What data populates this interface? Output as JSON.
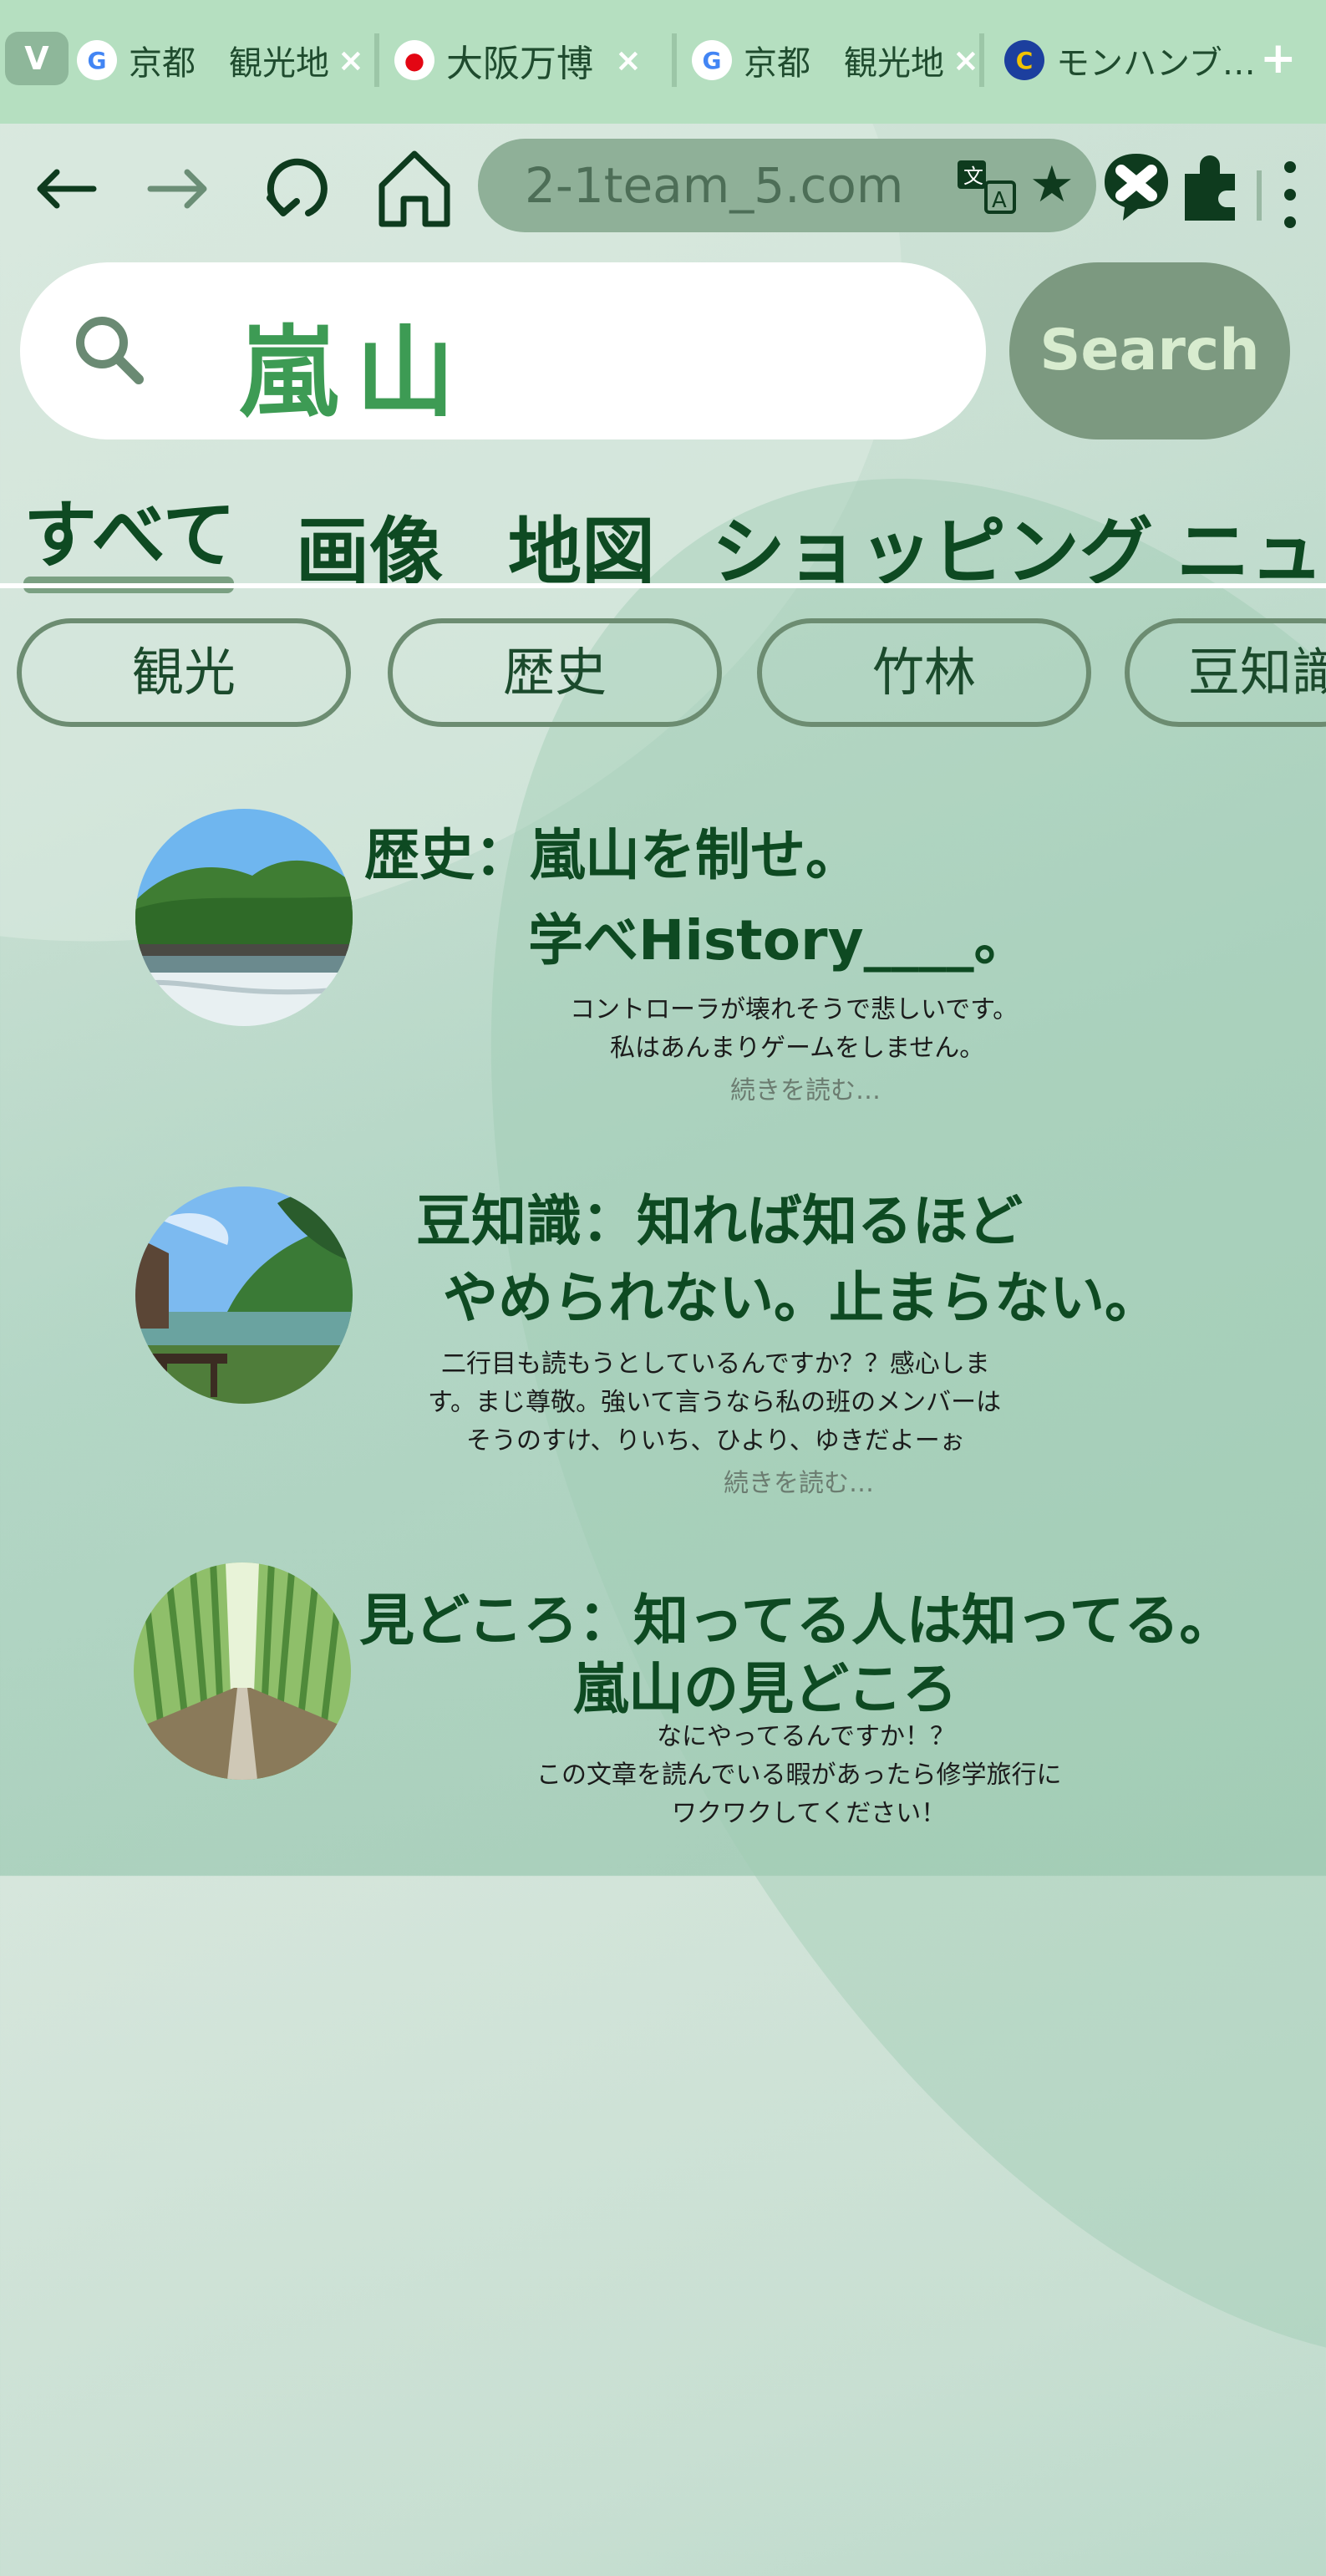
{
  "tabs": [
    {
      "title": "京都　観光地",
      "favicon": "google-icon"
    },
    {
      "title": "大阪万博",
      "favicon": "expo-icon"
    },
    {
      "title": "京都　観光地",
      "favicon": "google-icon"
    },
    {
      "title": "モンハンブ…",
      "favicon": "capcom-icon"
    }
  ],
  "tab_toggle": "V",
  "new_tab": "+",
  "address": {
    "url": "2-1team_5.com"
  },
  "search": {
    "query": "嵐山",
    "button": "Search"
  },
  "category_tabs": [
    "すべて",
    "画像",
    "地図",
    "ショッピング",
    "ニュー"
  ],
  "active_category": "すべて",
  "chips": [
    "観光",
    "歴史",
    "竹林",
    "豆知識"
  ],
  "results": [
    {
      "title_line1": "歴史：嵐山を制せ。",
      "title_line2": "学べHistory____。",
      "desc": [
        "コントローラが壊れそうで悲しいです。",
        "私はあんまりゲームをしません。"
      ],
      "more": "続きを読む…"
    },
    {
      "title_line1": "豆知識：知れば知るほど",
      "title_line2": "やめられない。止まらない。",
      "desc": [
        "二行目も読もうとしているんですか？？感心しま",
        "す。まじ尊敬。強いて言うなら私の班のメンバーは",
        "そうのすけ、りいち、ひより、ゆきだよーぉ"
      ],
      "more": "続きを読む…"
    },
    {
      "title_line1": "見どころ：知ってる人は知ってる。",
      "title_line2": "嵐山の見どころ",
      "desc": [
        "なにやってるんですか！？",
        "この文章を読んでいる暇があったら修学旅行に",
        "ワクワクしてください！"
      ],
      "more": ""
    }
  ],
  "colors": {
    "accent": "#3d9b54",
    "dark_green": "#0e4a22",
    "tabstrip": "#b5dfc0",
    "search_button": "#7c9980"
  }
}
